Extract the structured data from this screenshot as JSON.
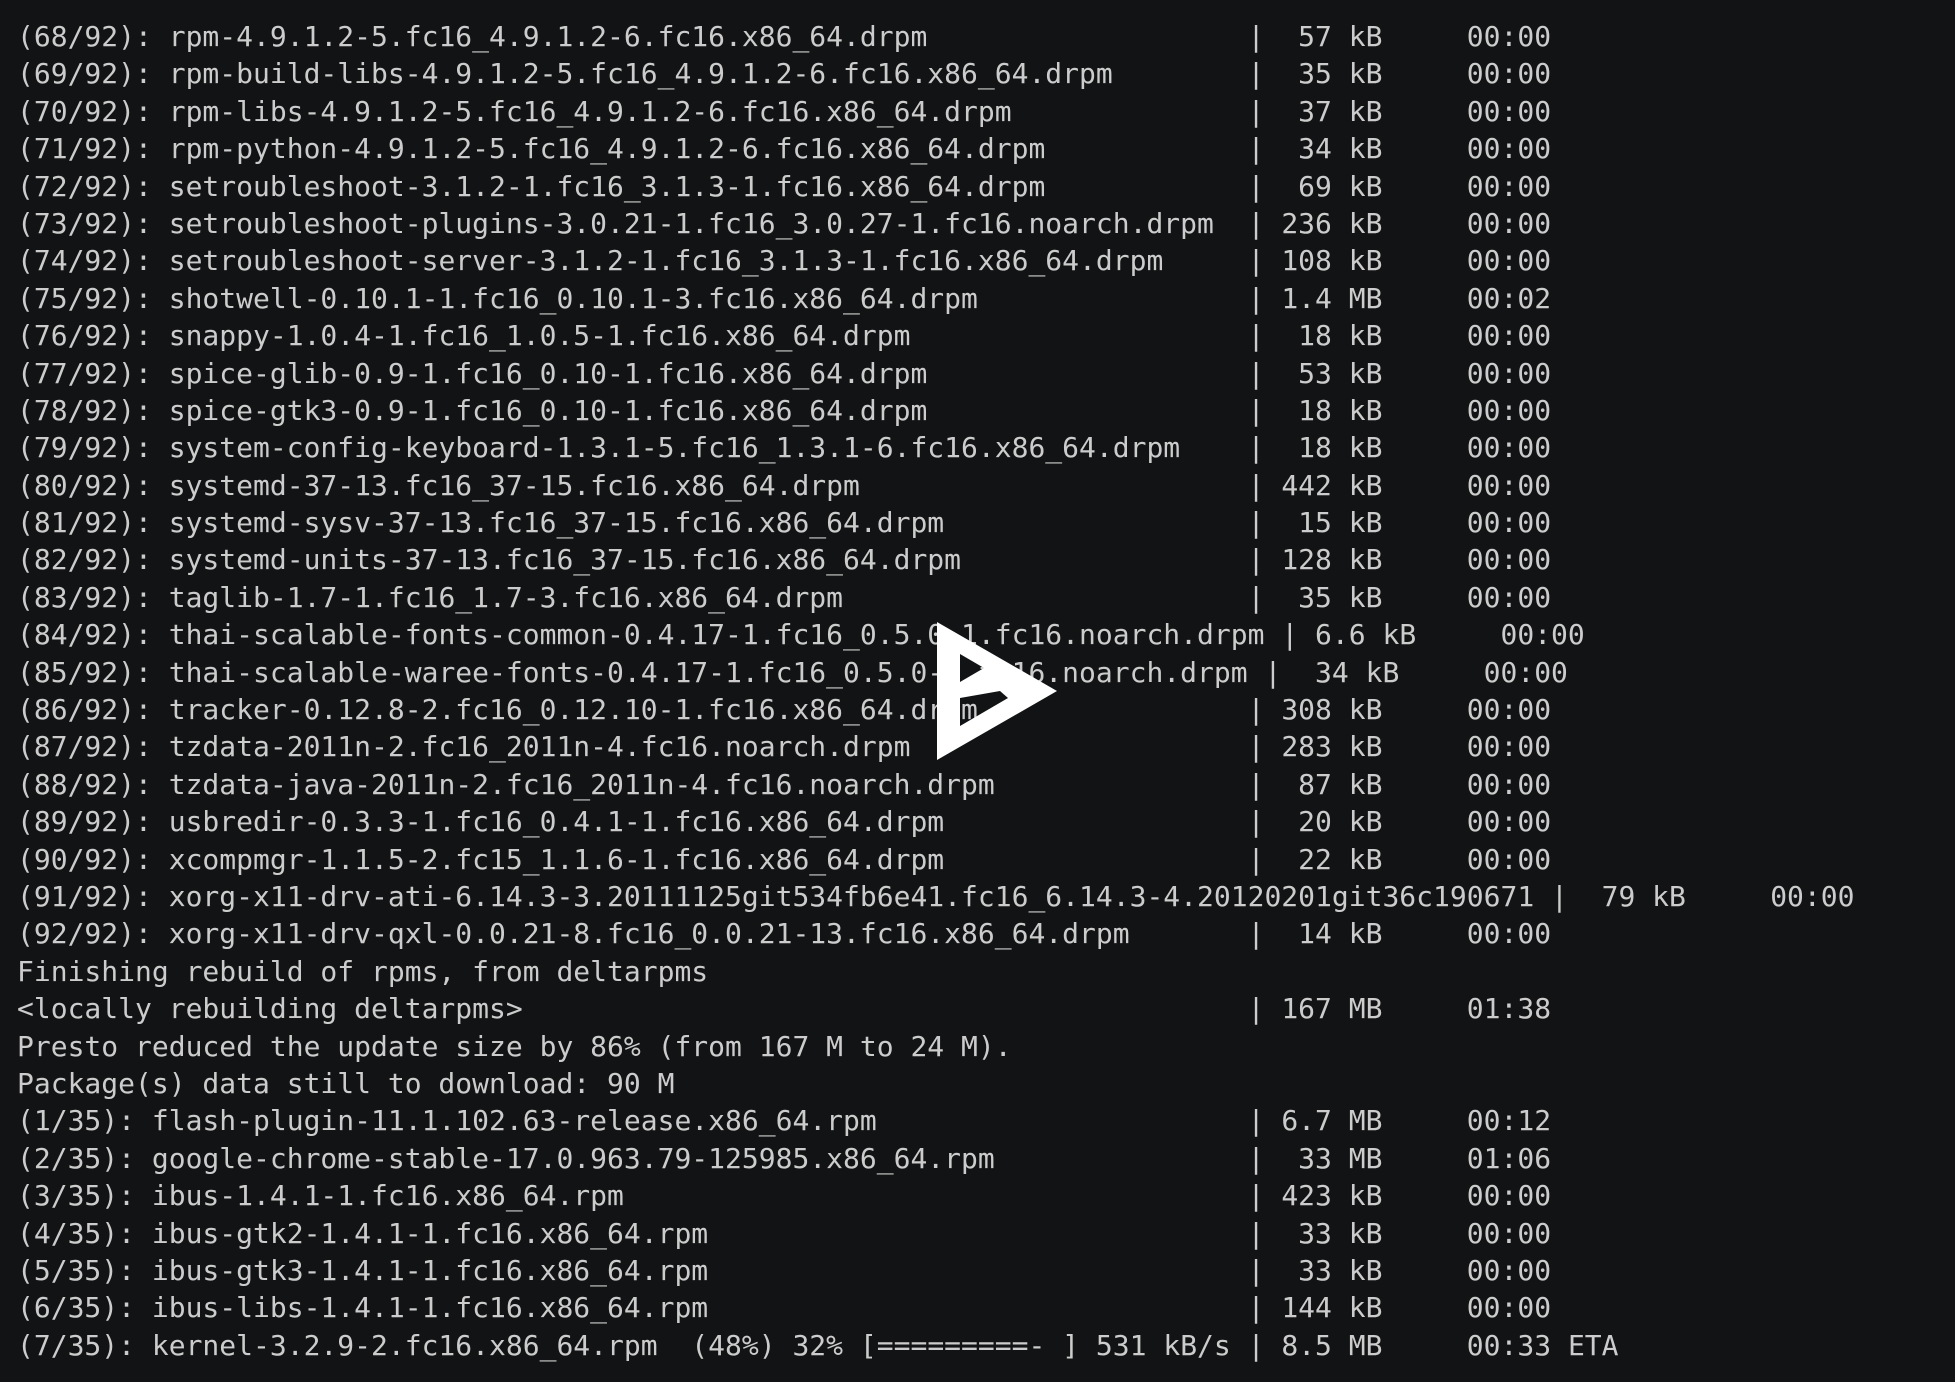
{
  "player": {
    "play_icon": "asciinema-play-icon",
    "colors": {
      "background": "#121314",
      "foreground": "#cccccc",
      "icon": "#ffffff"
    }
  },
  "terminal": {
    "delta_downloads": {
      "total": 92,
      "items": [
        {
          "index": 68,
          "name": "rpm-4.9.1.2-5.fc16_4.9.1.2-6.fc16.x86_64.drpm",
          "size": "57 kB",
          "time": "00:00"
        },
        {
          "index": 69,
          "name": "rpm-build-libs-4.9.1.2-5.fc16_4.9.1.2-6.fc16.x86_64.drpm",
          "size": "35 kB",
          "time": "00:00"
        },
        {
          "index": 70,
          "name": "rpm-libs-4.9.1.2-5.fc16_4.9.1.2-6.fc16.x86_64.drpm",
          "size": "37 kB",
          "time": "00:00"
        },
        {
          "index": 71,
          "name": "rpm-python-4.9.1.2-5.fc16_4.9.1.2-6.fc16.x86_64.drpm",
          "size": "34 kB",
          "time": "00:00"
        },
        {
          "index": 72,
          "name": "setroubleshoot-3.1.2-1.fc16_3.1.3-1.fc16.x86_64.drpm",
          "size": "69 kB",
          "time": "00:00"
        },
        {
          "index": 73,
          "name": "setroubleshoot-plugins-3.0.21-1.fc16_3.0.27-1.fc16.noarch.drpm",
          "size": "236 kB",
          "time": "00:00"
        },
        {
          "index": 74,
          "name": "setroubleshoot-server-3.1.2-1.fc16_3.1.3-1.fc16.x86_64.drpm",
          "size": "108 kB",
          "time": "00:00"
        },
        {
          "index": 75,
          "name": "shotwell-0.10.1-1.fc16_0.10.1-3.fc16.x86_64.drpm",
          "size": "1.4 MB",
          "time": "00:02"
        },
        {
          "index": 76,
          "name": "snappy-1.0.4-1.fc16_1.0.5-1.fc16.x86_64.drpm",
          "size": "18 kB",
          "time": "00:00"
        },
        {
          "index": 77,
          "name": "spice-glib-0.9-1.fc16_0.10-1.fc16.x86_64.drpm",
          "size": "53 kB",
          "time": "00:00"
        },
        {
          "index": 78,
          "name": "spice-gtk3-0.9-1.fc16_0.10-1.fc16.x86_64.drpm",
          "size": "18 kB",
          "time": "00:00"
        },
        {
          "index": 79,
          "name": "system-config-keyboard-1.3.1-5.fc16_1.3.1-6.fc16.x86_64.drpm",
          "size": "18 kB",
          "time": "00:00"
        },
        {
          "index": 80,
          "name": "systemd-37-13.fc16_37-15.fc16.x86_64.drpm",
          "size": "442 kB",
          "time": "00:00"
        },
        {
          "index": 81,
          "name": "systemd-sysv-37-13.fc16_37-15.fc16.x86_64.drpm",
          "size": "15 kB",
          "time": "00:00"
        },
        {
          "index": 82,
          "name": "systemd-units-37-13.fc16_37-15.fc16.x86_64.drpm",
          "size": "128 kB",
          "time": "00:00"
        },
        {
          "index": 83,
          "name": "taglib-1.7-1.fc16_1.7-3.fc16.x86_64.drpm",
          "size": "35 kB",
          "time": "00:00"
        },
        {
          "index": 84,
          "name": "thai-scalable-fonts-common-0.4.17-1.fc16_0.5.0-1.fc16.noarch.drpm",
          "size": "6.6 kB",
          "time": "00:00"
        },
        {
          "index": 85,
          "name": "thai-scalable-waree-fonts-0.4.17-1.fc16_0.5.0-1.fc16.noarch.drpm",
          "size": "34 kB",
          "time": "00:00"
        },
        {
          "index": 86,
          "name": "tracker-0.12.8-2.fc16_0.12.10-1.fc16.x86_64.drpm",
          "size": "308 kB",
          "time": "00:00"
        },
        {
          "index": 87,
          "name": "tzdata-2011n-2.fc16_2011n-4.fc16.noarch.drpm",
          "size": "283 kB",
          "time": "00:00"
        },
        {
          "index": 88,
          "name": "tzdata-java-2011n-2.fc16_2011n-4.fc16.noarch.drpm",
          "size": "87 kB",
          "time": "00:00"
        },
        {
          "index": 89,
          "name": "usbredir-0.3.3-1.fc16_0.4.1-1.fc16.x86_64.drpm",
          "size": "20 kB",
          "time": "00:00"
        },
        {
          "index": 90,
          "name": "xcompmgr-1.1.5-2.fc15_1.1.6-1.fc16.x86_64.drpm",
          "size": "22 kB",
          "time": "00:00"
        },
        {
          "index": 91,
          "name": "xorg-x11-drv-ati-6.14.3-3.20111125git534fb6e41.fc16_6.14.3-4.20120201git36c190671",
          "size": "79 kB",
          "time": "00:00"
        },
        {
          "index": 92,
          "name": "xorg-x11-drv-qxl-0.0.21-8.fc16_0.0.21-13.fc16.x86_64.drpm",
          "size": "14 kB",
          "time": "00:00"
        }
      ]
    },
    "rebuild": {
      "finishing_message": "Finishing rebuild of rpms, from deltarpms",
      "label": "<locally rebuilding deltarpms>",
      "size": "167 MB",
      "time": "01:38",
      "presto_message": "Presto reduced the update size by 86% (from 167 M to 24 M).",
      "remaining_message": "Package(s) data still to download: 90 M"
    },
    "package_downloads": {
      "total": 35,
      "items": [
        {
          "index": 1,
          "name": "flash-plugin-11.1.102.63-release.x86_64.rpm",
          "size": "6.7 MB",
          "time": "00:12"
        },
        {
          "index": 2,
          "name": "google-chrome-stable-17.0.963.79-125985.x86_64.rpm",
          "size": "33 MB",
          "time": "01:06"
        },
        {
          "index": 3,
          "name": "ibus-1.4.1-1.fc16.x86_64.rpm",
          "size": "423 kB",
          "time": "00:00"
        },
        {
          "index": 4,
          "name": "ibus-gtk2-1.4.1-1.fc16.x86_64.rpm",
          "size": "33 kB",
          "time": "00:00"
        },
        {
          "index": 5,
          "name": "ibus-gtk3-1.4.1-1.fc16.x86_64.rpm",
          "size": "33 kB",
          "time": "00:00"
        },
        {
          "index": 6,
          "name": "ibus-libs-1.4.1-1.fc16.x86_64.rpm",
          "size": "144 kB",
          "time": "00:00"
        }
      ],
      "in_progress": {
        "index": 7,
        "name": "kernel-3.2.9-2.fc16.x86_64.rpm",
        "overall_percent": "(48%)",
        "file_percent": "32%",
        "progress_bar": "[=========-                     ]",
        "rate": "531 kB/s",
        "size": "8.5 MB",
        "time": "00:33",
        "eta_label": "ETA"
      }
    }
  }
}
